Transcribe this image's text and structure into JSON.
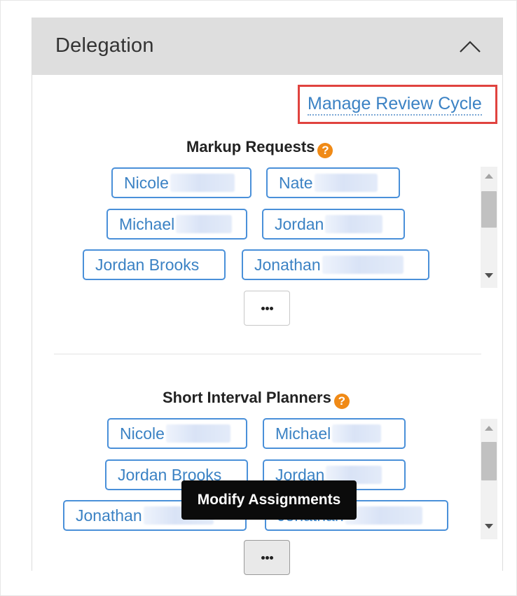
{
  "panel": {
    "title": "Delegation",
    "collapse_icon": "chevron-up-icon",
    "manage_link": "Manage Review Cycle"
  },
  "markup_requests": {
    "title": "Markup Requests",
    "help_glyph": "?",
    "assignees": [
      "Nicole",
      "Nate",
      "Michael",
      "Jordan",
      "Jordan Brooks",
      "Jonathan"
    ],
    "more_icon": "ellipsis-icon"
  },
  "short_interval_planners": {
    "title": "Short Interval Planners",
    "help_glyph": "?",
    "assignees": [
      "Nicole",
      "Michael",
      "Jordan Brooks",
      "Jordan",
      "Jonathan",
      "Jonathan"
    ],
    "more_icon": "ellipsis-icon"
  },
  "tooltip": {
    "text": "Modify Assignments"
  },
  "colors": {
    "accent": "#3b82c4",
    "help": "#f08a16",
    "highlight_border": "#e0433f",
    "header_bg": "#dedede"
  }
}
